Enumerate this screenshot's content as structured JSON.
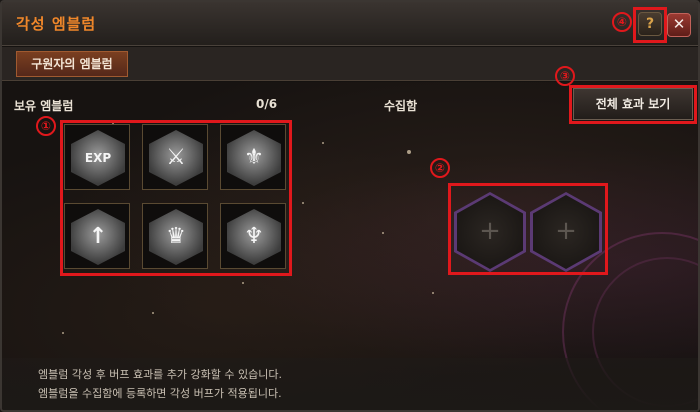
{
  "window": {
    "title": "각성 엠블럼",
    "help_label": "?",
    "close_label": "✕"
  },
  "tab": {
    "label": "구원자의 엠블럼"
  },
  "owned": {
    "label": "보유 엠블럼",
    "count": "0/6"
  },
  "collection": {
    "label": "수집함",
    "slot_symbol": "+"
  },
  "all_effects_button": {
    "label": "전체 효과 보기"
  },
  "emblems": [
    {
      "name": "exp-emblem",
      "glyph": "EXP",
      "icon": "exp-laurel-icon"
    },
    {
      "name": "sword-wings-emblem",
      "glyph": "⚔",
      "icon": "winged-sword-icon"
    },
    {
      "name": "fleur-emblem",
      "glyph": "⚜",
      "icon": "fleur-icon"
    },
    {
      "name": "spear-emblem",
      "glyph": "↑",
      "icon": "crossed-spear-icon"
    },
    {
      "name": "crown-emblem",
      "glyph": "♛",
      "icon": "crown-icon"
    },
    {
      "name": "figure-emblem",
      "glyph": "♆",
      "icon": "figure-icon"
    }
  ],
  "annotations": [
    "①",
    "②",
    "③",
    "④"
  ],
  "footer": {
    "line1": "엠블럼 각성 후 버프 효과를 추가 강화할 수 있습니다.",
    "line2": "엠블럼을 수집함에 등록하면 각성 버프가 적용됩니다."
  },
  "colors": {
    "accent": "#f0872a",
    "annotation": "#e0181c",
    "slot_border": "#5b3a74"
  }
}
